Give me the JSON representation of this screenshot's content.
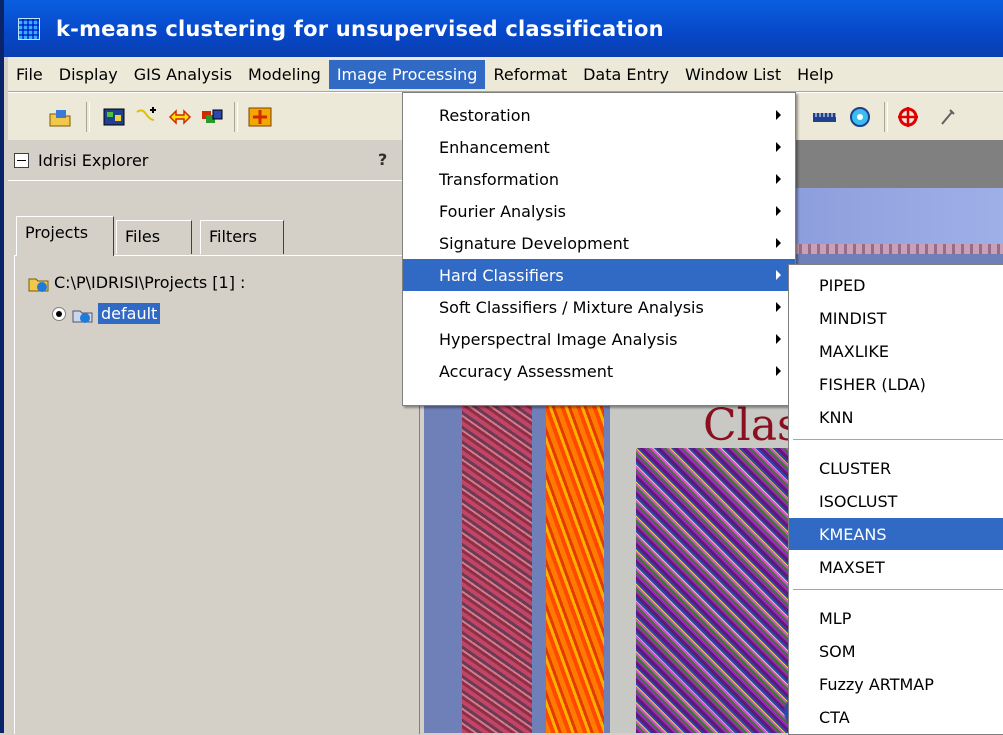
{
  "window": {
    "title": "k-means clustering for unsupervised classification"
  },
  "menubar": {
    "items": [
      "File",
      "Display",
      "GIS Analysis",
      "Modeling",
      "Image Processing",
      "Reformat",
      "Data Entry",
      "Window List",
      "Help"
    ],
    "active_index": 4
  },
  "toolbar": {
    "icons": [
      "open-icon",
      "display-map-icon",
      "digitize-icon",
      "swap-arrows-icon",
      "layer-composite-icon",
      "pan-icon",
      "scale-bar-icon",
      "circle-target-icon",
      "crosshair-icon",
      "tools-icon"
    ]
  },
  "explorer": {
    "title": "Idrisi Explorer",
    "help_glyph": "?",
    "tabs": [
      "Projects",
      "Files",
      "Filters"
    ],
    "selected_tab": "Projects",
    "tree": {
      "root_label": "C:\\P\\IDRISI\\Projects [1] :",
      "child_label": "default"
    }
  },
  "canvas": {
    "title_text": "Clas"
  },
  "image_processing_menu": {
    "items": [
      {
        "label": "Restoration",
        "submenu": true
      },
      {
        "label": "Enhancement",
        "submenu": true
      },
      {
        "label": "Transformation",
        "submenu": true
      },
      {
        "label": "Fourier Analysis",
        "submenu": true
      },
      {
        "label": "Signature Development",
        "submenu": true
      },
      {
        "label": "Hard Classifiers",
        "submenu": true,
        "selected": true
      },
      {
        "label": "Soft Classifiers / Mixture Analysis",
        "submenu": true
      },
      {
        "label": "Hyperspectral Image Analysis",
        "submenu": true
      },
      {
        "label": "Accuracy Assessment",
        "submenu": true
      }
    ]
  },
  "hard_classifiers_menu": {
    "groups": [
      [
        "PIPED",
        "MINDIST",
        "MAXLIKE",
        "FISHER (LDA)",
        "KNN"
      ],
      [
        "CLUSTER",
        "ISOCLUST",
        "KMEANS",
        "MAXSET"
      ],
      [
        "MLP",
        "SOM",
        "Fuzzy ARTMAP",
        "CTA"
      ]
    ],
    "selected": "KMEANS"
  },
  "colors": {
    "accent": "#316ac5",
    "titlebar": "#0647c8",
    "menu_bg": "#ece9d8"
  }
}
